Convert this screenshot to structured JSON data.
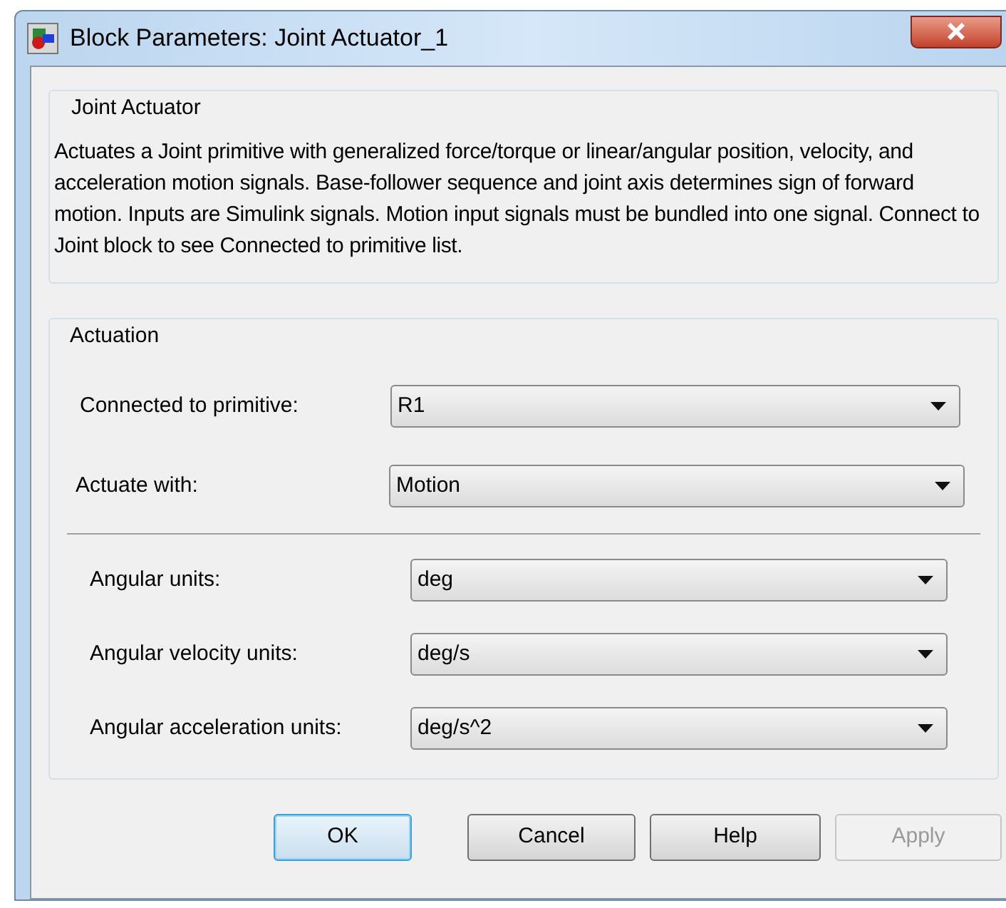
{
  "window": {
    "title": "Block Parameters: Joint Actuator_1"
  },
  "description_group": {
    "title": "Joint Actuator",
    "text": "Actuates a Joint primitive with generalized force/torque or linear/angular position, velocity, and acceleration motion signals. Base-follower sequence and joint axis determines sign of forward motion. Inputs are Simulink signals. Motion input signals must be bundled into one signal. Connect to Joint block to see Connected to primitive list."
  },
  "actuation": {
    "title": "Actuation",
    "primary": [
      {
        "label": "Connected to primitive:",
        "value": "R1"
      },
      {
        "label": "Actuate with:",
        "value": "Motion"
      }
    ],
    "units": [
      {
        "label": "Angular units:",
        "value": "deg"
      },
      {
        "label": "Angular velocity units:",
        "value": "deg/s"
      },
      {
        "label": "Angular acceleration units:",
        "value": "deg/s^2"
      }
    ]
  },
  "buttons": [
    {
      "label": "OK",
      "kind": "default",
      "disabled": false
    },
    {
      "label": "Cancel",
      "kind": "normal",
      "disabled": false
    },
    {
      "label": "Help",
      "kind": "normal",
      "disabled": false
    },
    {
      "label": "Apply",
      "kind": "normal",
      "disabled": true
    }
  ]
}
